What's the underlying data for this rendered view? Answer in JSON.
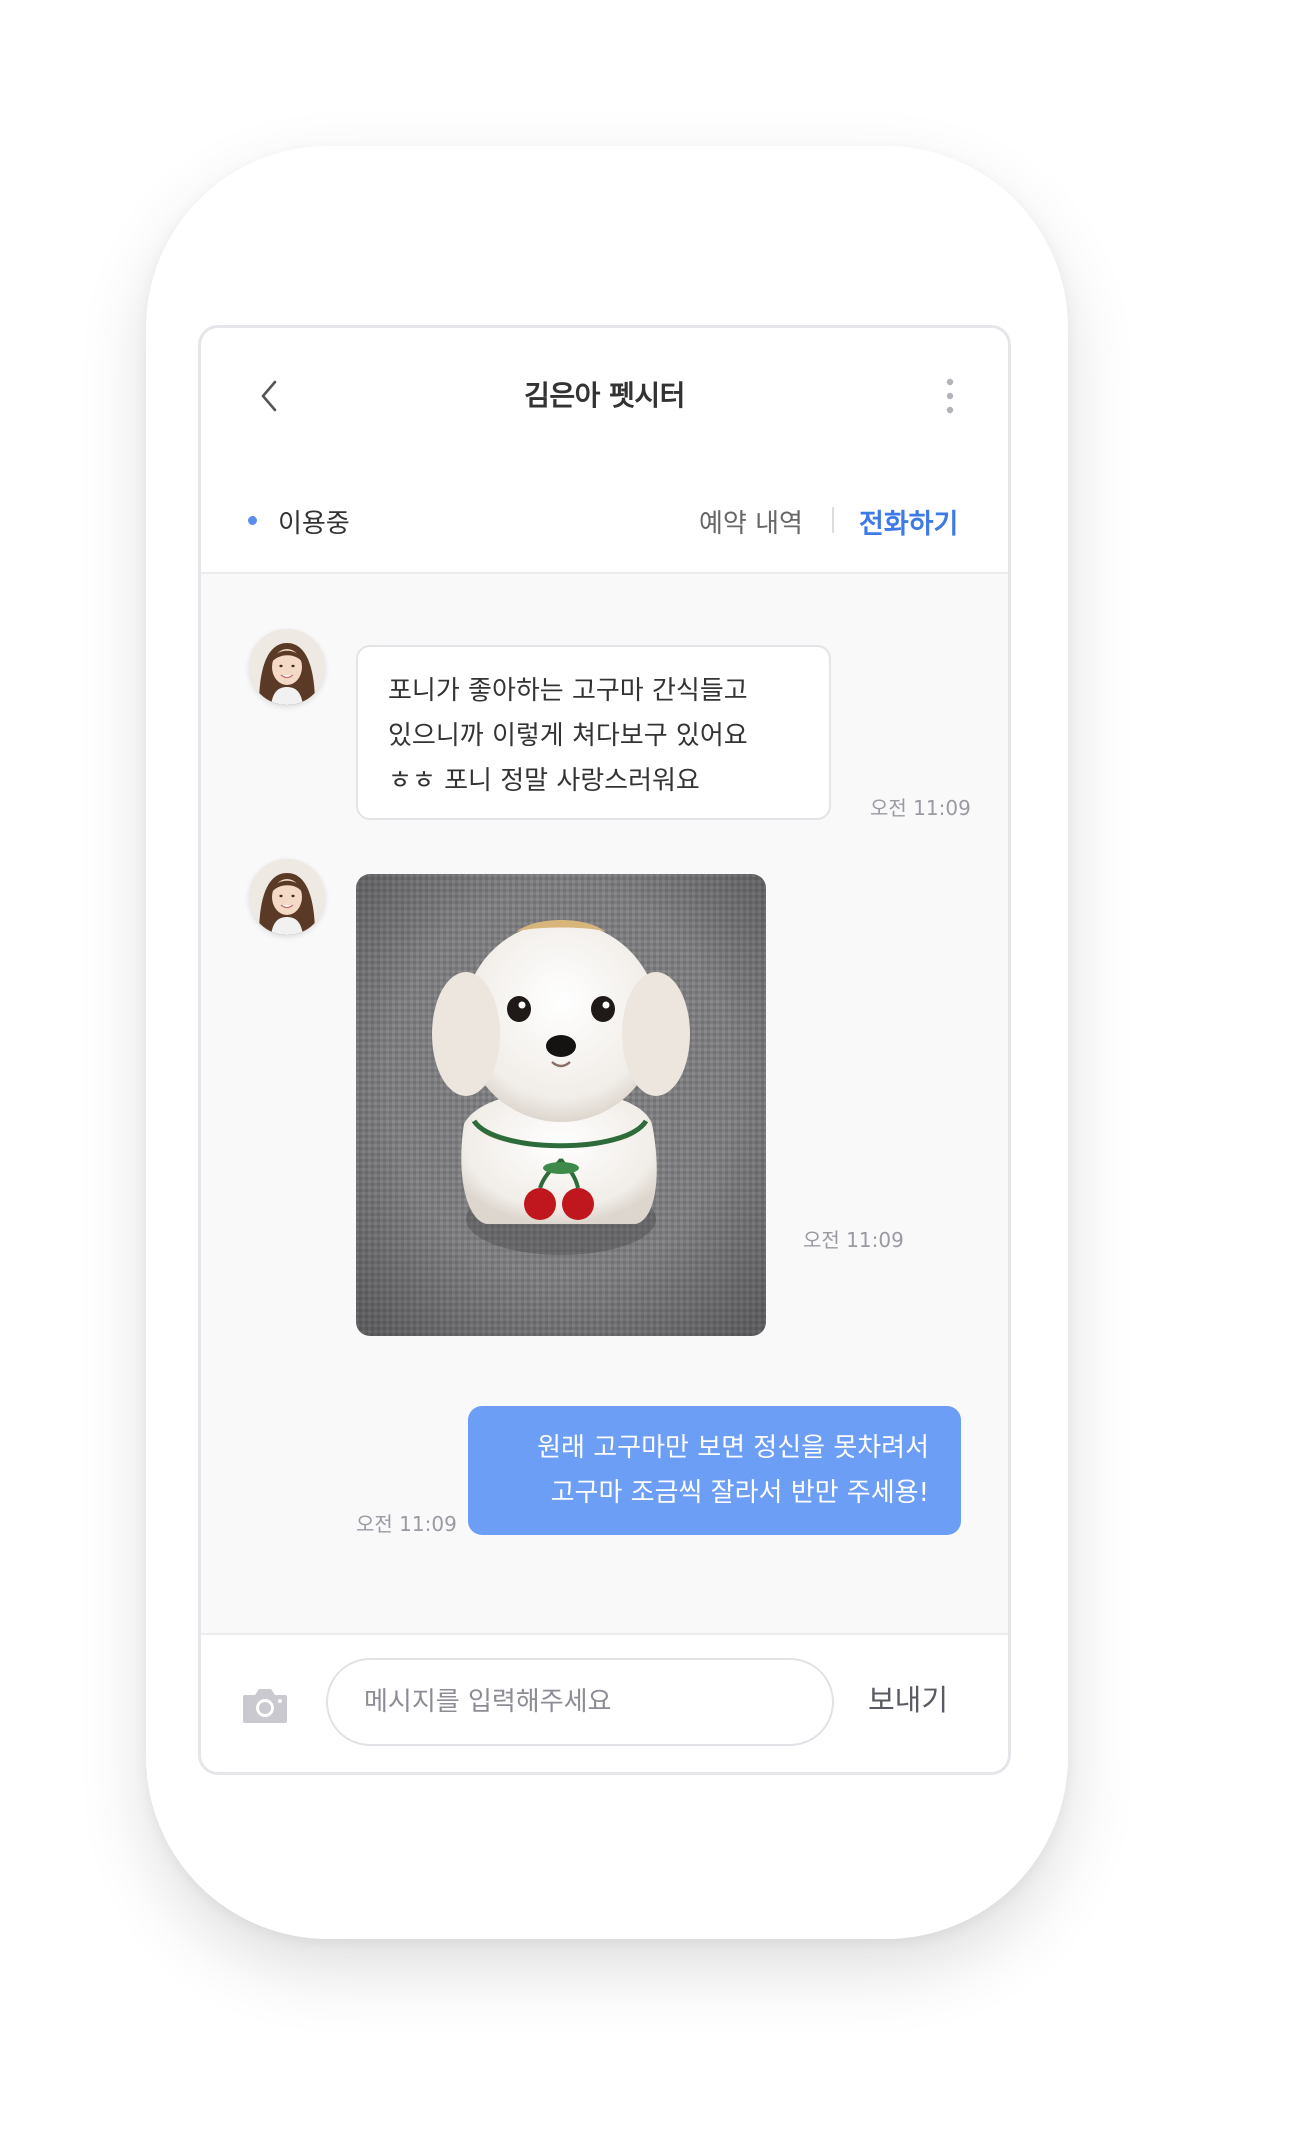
{
  "header": {
    "title": "김은아 펫시터",
    "back_icon": "chevron-left-icon",
    "more_icon": "more-vertical-icon"
  },
  "status_bar": {
    "status": "이용중",
    "reservations_label": "예약 내역",
    "call_label": "전화하기",
    "accent_color": "#3d7ae6"
  },
  "messages": [
    {
      "sender": "sitter",
      "type": "text",
      "lines": [
        "포니가 좋아하는 고구마 간식들고",
        "있으니까 이렇게 쳐다보구 있어요",
        "ㅎㅎ 포니 정말 사랑스러워요"
      ],
      "time": "오전 11:09"
    },
    {
      "sender": "sitter",
      "type": "image",
      "image_desc": "dog-photo",
      "time": "오전 11:09"
    },
    {
      "sender": "me",
      "type": "text",
      "lines": [
        "원래 고구마만 보면 정신을 못차려서",
        "고구마 조금씩 잘라서 반만 주세용!"
      ],
      "time": "오전 11:09"
    }
  ],
  "composer": {
    "placeholder": "메시지를 입력해주세요",
    "value": "",
    "send_label": "보내기",
    "camera_icon": "camera-icon"
  },
  "colors": {
    "outgoing_bubble": "#6b9ef4",
    "chat_background": "#f9f9fa"
  }
}
